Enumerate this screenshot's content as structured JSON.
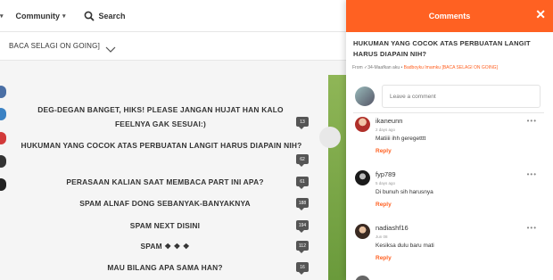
{
  "nav": {
    "left_caret": "▾",
    "community_label": "Community",
    "community_caret": "▾",
    "search_label": "Search"
  },
  "story": {
    "title": "BACA SELAGI ON GOING]"
  },
  "parts": [
    {
      "title": "DEG-DEGAN BANGET, HIKS! PLEASE JANGAN HUJAT HAN KALO FEELNYA GAK SESUAI:)",
      "count": "13"
    },
    {
      "title": "HUKUMAN YANG COCOK ATAS PERBUATAN LANGIT HARUS DIAPAIN NIH?",
      "count": "62"
    },
    {
      "title": "PERASAAN KALIAN SAAT MEMBACA PART INI APA?",
      "count": "61"
    },
    {
      "title": "SPAM ALNAF DONG SEBANYAK-BANYAKNYA",
      "count": "188"
    },
    {
      "title": "SPAM NEXT DISINI",
      "count": "194"
    },
    {
      "title": "SPAM ❖ ❖ ❖",
      "count": "112"
    },
    {
      "title": "MAU BILANG APA SAMA HAN?",
      "count": "16"
    }
  ],
  "drawer": {
    "header": "Comments",
    "close_symbol": "✕",
    "title": "HUKUMAN YANG COCOK ATAS PERBUATAN LANGIT HARUS DIAPAIN NIH?",
    "from_prefix": "From ✓34-Maafkan aku  •",
    "from_story": "Badboyku Imamku [BACA SELAGI ON GOING]",
    "comment_placeholder": "Leave a comment"
  },
  "comments": [
    {
      "user": "ikaneunn",
      "time": "2 days ago",
      "body": "Matiiii ihh geregetttt",
      "reply": "Reply",
      "more": "•••"
    },
    {
      "user": "fyp789",
      "time": "5 days ago",
      "body": "Di bunuh sih harusnya",
      "reply": "Reply",
      "more": "•••"
    },
    {
      "user": "nadiashf16",
      "time": "Jun 08",
      "body": "Kesiksa dulu baru mati",
      "reply": "Reply",
      "more": "•••"
    }
  ],
  "colors": {
    "accent": "#ff6122",
    "badge": "#555555",
    "green_image": "#7aa646"
  },
  "icons": [
    "search-icon",
    "chevron-down-icon",
    "close-icon",
    "comment-count-icon",
    "more-icon"
  ]
}
